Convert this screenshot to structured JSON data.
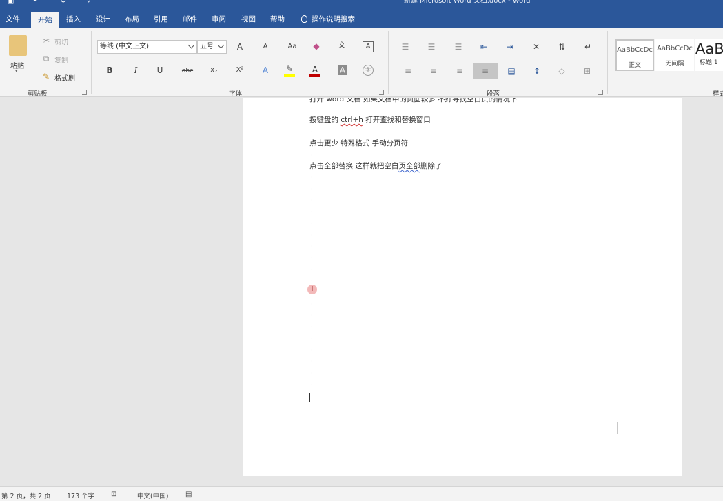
{
  "window": {
    "title": "新建 Microsoft Word 文档.docx  -  Word",
    "quick_access": [
      "save-icon",
      "undo-icon",
      "redo-icon",
      "customize-icon"
    ]
  },
  "tabs": {
    "file": "文件",
    "home": "开始",
    "insert": "插入",
    "design": "设计",
    "layout": "布局",
    "references": "引用",
    "mailings": "邮件",
    "review": "审阅",
    "view": "视图",
    "help": "帮助",
    "tell_me": "操作说明搜索"
  },
  "clipboard": {
    "paste": "粘贴",
    "cut": "剪切",
    "copy": "复制",
    "format_painter": "格式刷",
    "group": "剪贴板"
  },
  "font": {
    "font_name": "等线 (中文正文)",
    "font_size": "五号",
    "bold": "B",
    "italic": "I",
    "underline": "U",
    "strike": "abc",
    "subscript": "X₂",
    "superscript": "X²",
    "change_case": "Aa",
    "grow": "A",
    "shrink": "A",
    "font_color": "A",
    "shading": "A",
    "border": "A",
    "phonetic": "文",
    "enclose": "字",
    "group": "字体",
    "accent_red": "#c00000",
    "highlight_yellow": "#ffff00"
  },
  "paragraph": {
    "group": "段落"
  },
  "styles": {
    "items": [
      {
        "preview": "AaBbCcDc",
        "name": "正文"
      },
      {
        "preview": "AaBbCcDc",
        "name": "无间隔"
      },
      {
        "preview": "AaB",
        "name": "标题 1"
      }
    ],
    "group": "样式"
  },
  "document": {
    "line0": "打开 word 文档 如果文档中的页面较多 不好寻找空白页的情况下",
    "line1_pre": "按键盘的 ",
    "line1_link": "ctrl+h",
    "line1_post": " 打开查找和替换窗口",
    "line2": "点击更少  特殊格式  手动分页符",
    "line3_pre": "点击全部替换  这样就把空白",
    "line3_mid": "页全部",
    "line3_post": "删除了"
  },
  "status": {
    "page": "第 2 页，共 2 页",
    "words": "173 个字",
    "language": "中文(中国)"
  }
}
